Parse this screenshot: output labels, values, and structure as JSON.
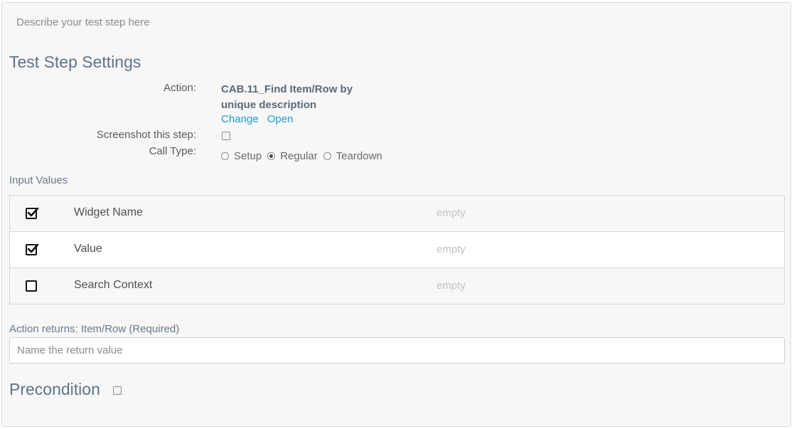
{
  "description_placeholder": "Describe your test step here",
  "section_title": "Test Step Settings",
  "action": {
    "label": "Action:",
    "name": "CAB.11_Find Item/Row by unique description",
    "change_link": "Change",
    "open_link": "Open"
  },
  "screenshot": {
    "label": "Screenshot this step:",
    "checked": false
  },
  "call_type": {
    "label": "Call Type:",
    "options": [
      "Setup",
      "Regular",
      "Teardown"
    ],
    "selected": "Regular"
  },
  "input_values": {
    "title": "Input Values",
    "rows": [
      {
        "name": "Widget Name",
        "value": "empty",
        "checked": true
      },
      {
        "name": "Value",
        "value": "empty",
        "checked": true
      },
      {
        "name": "Search Context",
        "value": "empty",
        "checked": false
      }
    ]
  },
  "returns": {
    "label": "Action returns: Item/Row (Required)",
    "placeholder": "Name the return value"
  },
  "precondition": {
    "label": "Precondition",
    "checked": false
  }
}
